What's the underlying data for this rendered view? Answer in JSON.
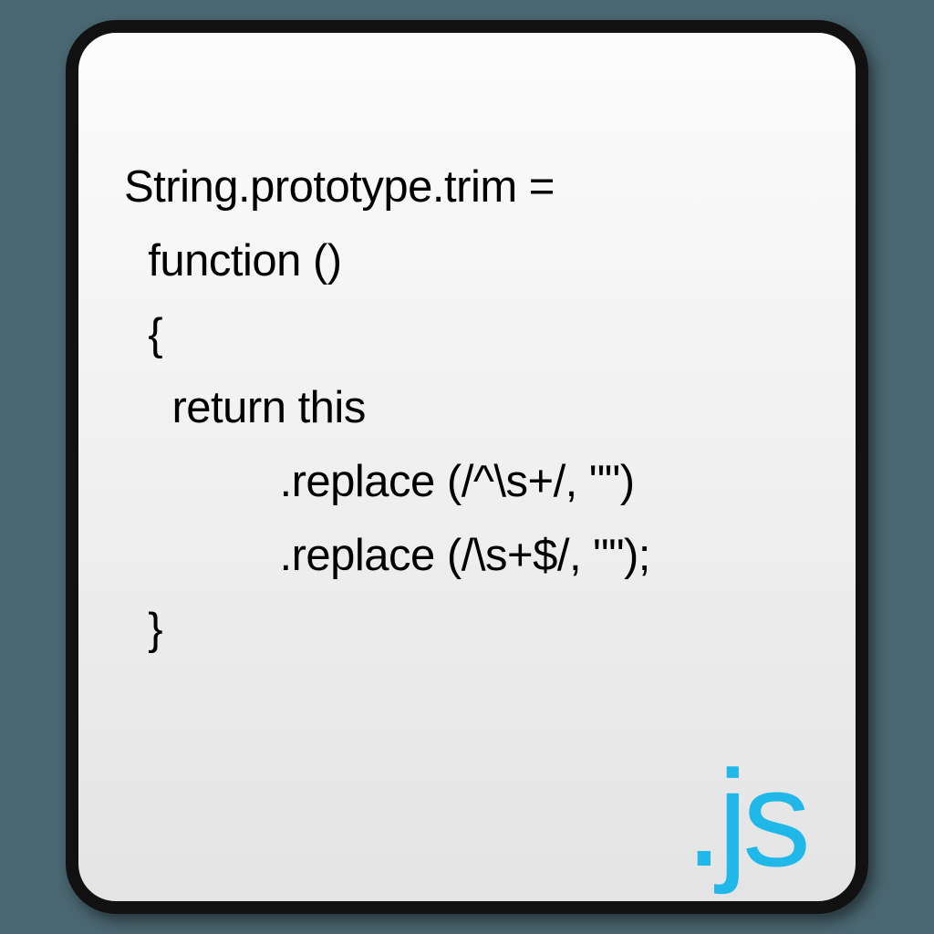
{
  "code": {
    "line1": "String.prototype.trim =",
    "line2": "  function ()",
    "line3": "  {",
    "line4": "    return this",
    "line5": "             .replace (/^\\s+/, \"\")",
    "line6": "             .replace (/\\s+$/, \"\");",
    "line7": "  }"
  },
  "extension_label": ".js",
  "colors": {
    "accent": "#1fb8e8",
    "border": "#111111",
    "background": "#4a6670"
  }
}
